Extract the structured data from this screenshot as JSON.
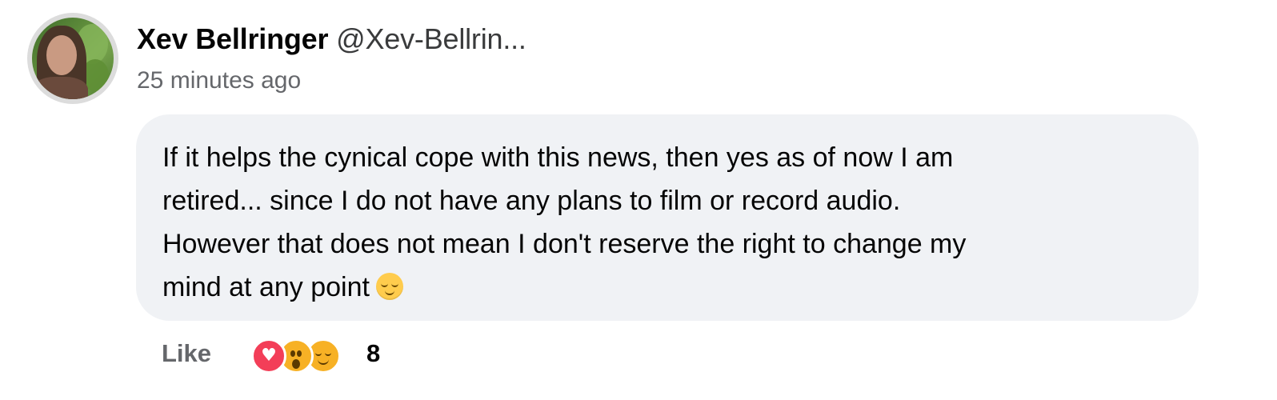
{
  "comment": {
    "author_name": "Xev Bellringer",
    "author_handle": "@Xev-Bellrin...",
    "timestamp": "25 minutes ago",
    "text_lines": [
      "If it helps the cynical cope with this news, then yes as of now I am",
      "retired... since I do not have any plans to film or record audio.",
      "However that does not mean I don't reserve the right to change my",
      "mind at any point"
    ],
    "inline_emoji": "relieved-face-icon"
  },
  "actions": {
    "like_label": "Like"
  },
  "reactions": {
    "icons": [
      "love-reaction-icon",
      "wow-reaction-icon",
      "smile-reaction-icon"
    ],
    "count": "8"
  },
  "colors": {
    "bubble_bg": "#f0f2f5",
    "secondary_text": "#65676b",
    "love_red": "#f33e58",
    "emoji_yellow": "#f7b125"
  }
}
